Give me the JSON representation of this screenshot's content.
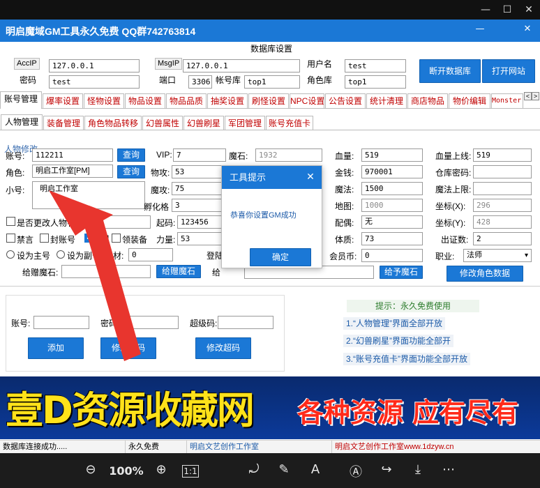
{
  "window": {
    "minimize": "—",
    "maximize": "☐",
    "close": "✕"
  },
  "app": {
    "title": "明启魔域GM工具永久免费 QQ群742763814",
    "min": "—",
    "close": "✕"
  },
  "db": {
    "title": "数据库设置",
    "acc_ip_label": "AccIP",
    "acc_ip": "127.0.0.1",
    "msg_ip_label": "MsgIP",
    "msg_ip": "127.0.0.1",
    "user_label": "用户名",
    "user": "test",
    "pwd_label": "密码",
    "pwd": "test",
    "port_label": "端口",
    "port": "3306",
    "acc_db_label": "帐号库",
    "acc_db": "top1",
    "role_db_label": "角色库",
    "role_db": "top1",
    "disconnect": "断开数据库",
    "open_site": "打开网站"
  },
  "tabs": [
    "账号管理",
    "爆率设置",
    "怪物设置",
    "物品设置",
    "物品品质",
    "抽奖设置",
    "刷怪设置",
    "NPC设置",
    "公告设置",
    "统计清理",
    "商店物品",
    "物价编辑",
    "Monster.dat"
  ],
  "tab_scroll": {
    "left": "<",
    "right": ">"
  },
  "subtabs": [
    "人物管理",
    "装备管理",
    "角色物品转移",
    "幻兽属性",
    "幻兽刷星",
    "军团管理",
    "账号充值卡"
  ],
  "char": {
    "group": "人物修改",
    "account_label": "账号:",
    "account": "112211",
    "query": "查询",
    "role_label": "角色:",
    "role": "明启工作室[PM]",
    "query2": "查询",
    "nick_label": "小号:",
    "nick": "明启工作室",
    "vip_label": "VIP:",
    "vip": "7",
    "atk_label": "物攻:",
    "atk": "53",
    "matk_label": "魔攻:",
    "matk": "75",
    "hatch_label": "孵化格",
    "hatch": "3",
    "rename_label": "是否更改人物名",
    "ban_label": "禁言",
    "seal_label": "封账号",
    "gm_label": "GM",
    "equip_label": "领装备",
    "power_label": "力量:",
    "power": "53",
    "wood_label": "木材:",
    "wood": "0",
    "login_label": "登陆",
    "main_label": "设为主号",
    "sub_label": "设为副号",
    "give_stone_label": "给赠魔石:",
    "give_stone_btn": "给赠魔石",
    "give_label": "给",
    "magic_label": "魔石:",
    "magic": "1932",
    "pwd2_label": "起码:",
    "pwd2": "123456",
    "hp_label": "血量:",
    "hp": "519",
    "money_label": "金钱:",
    "money": "970001",
    "mp_label": "魔法:",
    "mp": "1500",
    "map_label": "地图:",
    "map": "1000",
    "spouse_label": "配偶:",
    "spouse": "无",
    "phys_label": "体质:",
    "phys": "73",
    "member_label": "会员币:",
    "member": "0",
    "give_magic_btn": "给予魔石",
    "hpmax_label": "血量上线:",
    "hpmax": "519",
    "wh_label": "仓库密码:",
    "wh": "",
    "mpmax_label": "魔法上限:",
    "mpmax": "",
    "x_label": "坐标(X):",
    "x": "296",
    "y_label": "坐标(Y):",
    "y": "428",
    "cert_label": "出证数:",
    "cert": "2",
    "job_label": "职业:",
    "job": "法师",
    "save_btn": "修改角色数据"
  },
  "dialog": {
    "title": "工具提示",
    "close": "✕",
    "message": "恭喜你设置GM成功",
    "ok": "确定"
  },
  "lower": {
    "acc_label": "账号:",
    "pwd_label": "密码:",
    "super_label": "超级码:",
    "add": "添加",
    "change_pwd": "修改密码",
    "change_super": "修改超码"
  },
  "tips": {
    "head": "提示：永久免费使用",
    "t1": "1.“人物管理”界面全部开放",
    "t2": "2.“幻兽刷星”界面功能全部开",
    "t3": "3.“账号充值卡”界面功能全部开放"
  },
  "banner": {
    "left": "壹D资源收藏网",
    "right": "各种资源 应有尽有"
  },
  "status": {
    "s1": "数据库连接成功.....",
    "s2": "永久免费",
    "s3": "明启文艺创作工作室",
    "s4": "明启文艺创作工作室www.1dzyw.cn"
  },
  "viewer": {
    "zoom": "100%",
    "zoom_out": "⊖",
    "zoom_in": "⊕",
    "actual": "1:1",
    "rotate": "⤾",
    "edit": "✎",
    "translate": "A",
    "ocr": "Ⓐ",
    "share": "↪",
    "download": "⤓",
    "more": "⋯"
  },
  "colors": {
    "accent": "#1b78d6",
    "tab_text": "#c00000",
    "banner_yellow": "#ffe21a",
    "banner_red": "#ff2a1a"
  }
}
